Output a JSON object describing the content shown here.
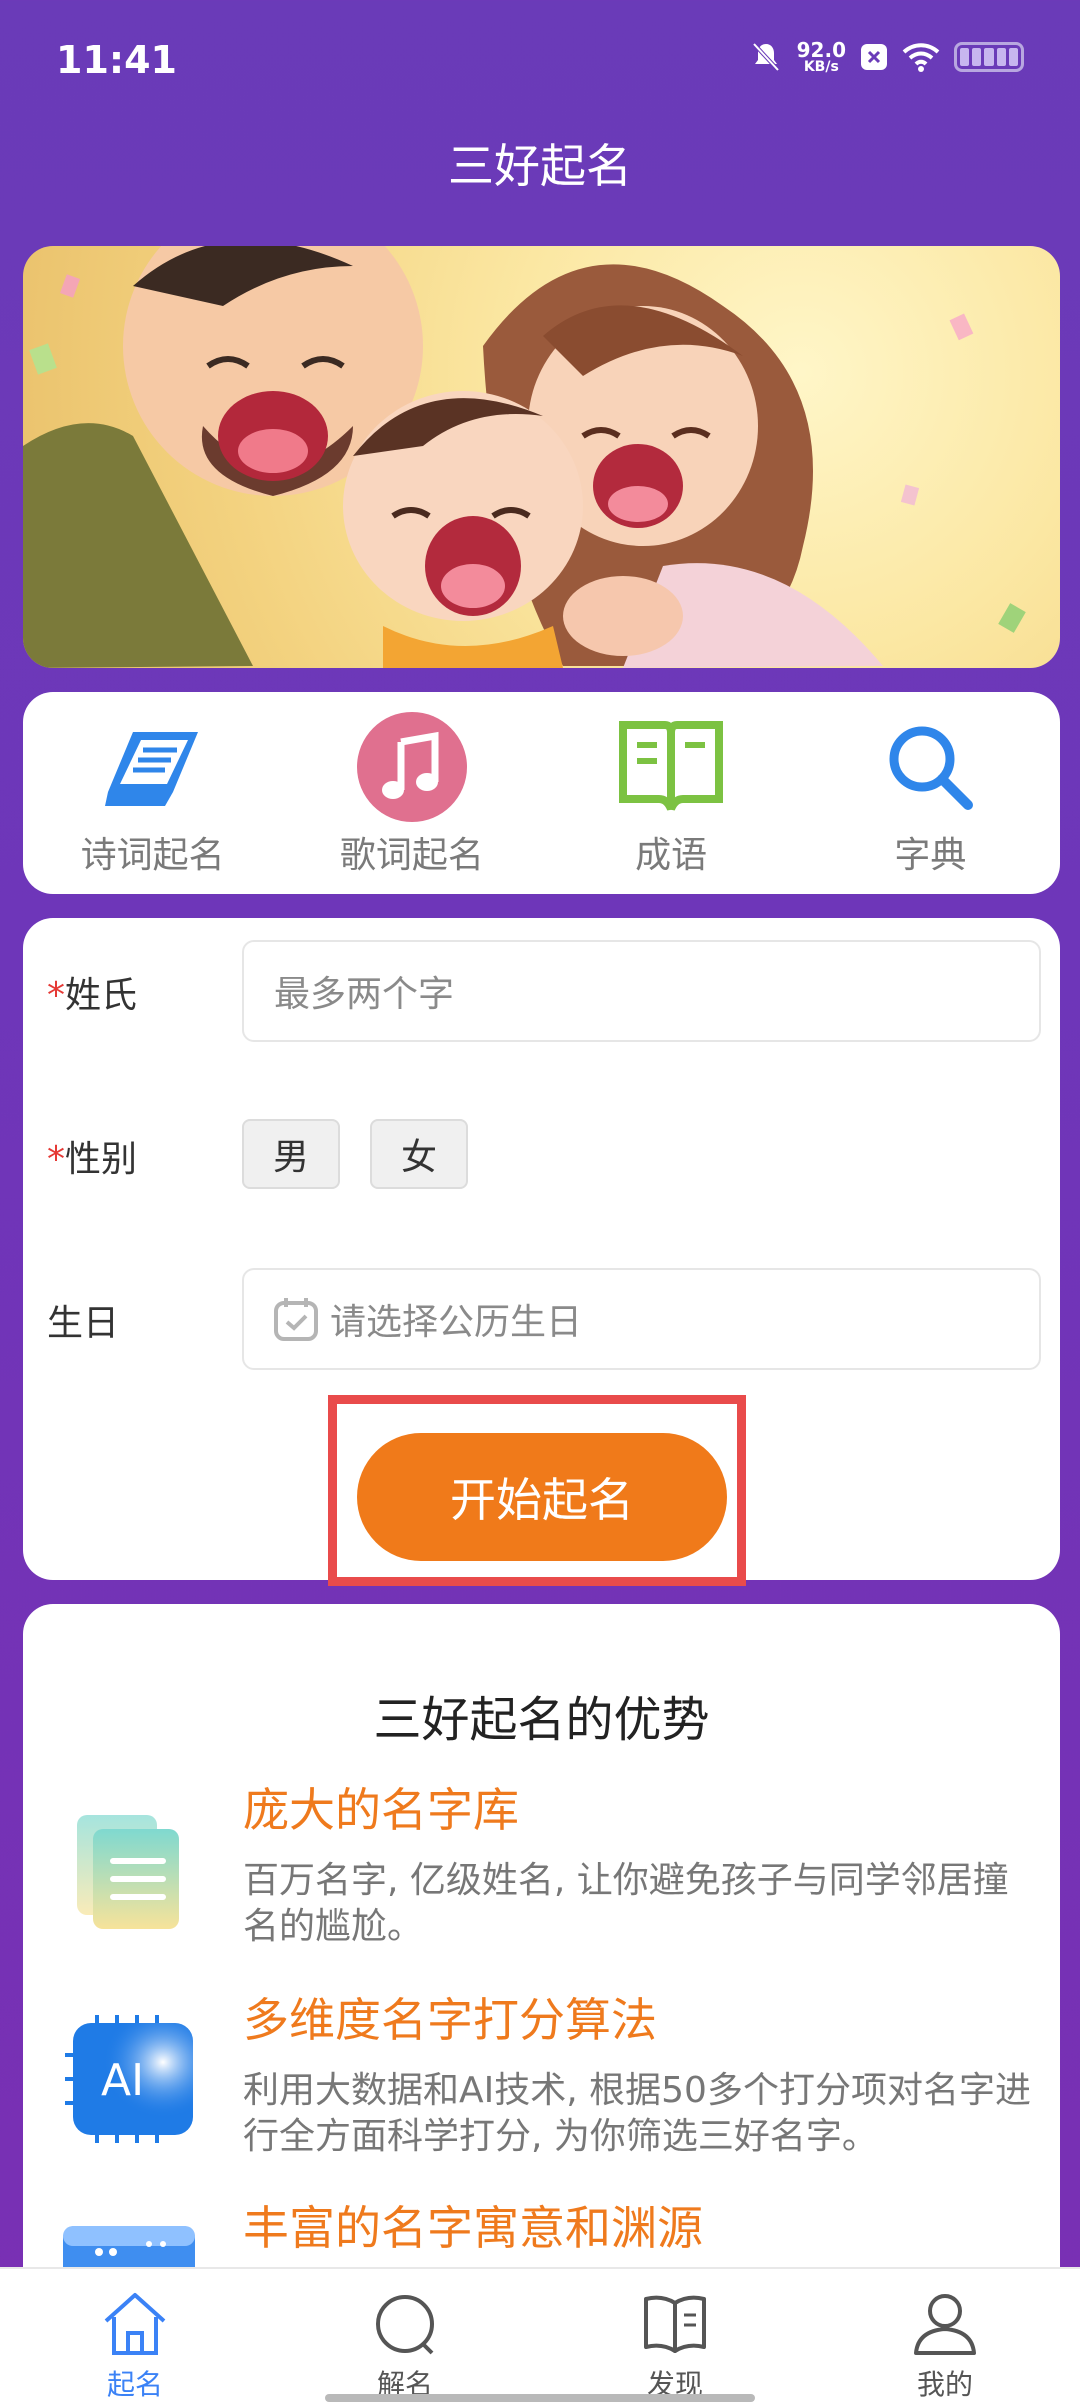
{
  "status": {
    "time": "11:41",
    "net_speed": "92.0",
    "net_unit": "KB/s"
  },
  "app_title": "三好起名",
  "quick_links": [
    {
      "label": "诗词起名",
      "icon": "book-icon",
      "color": "#2f86ea"
    },
    {
      "label": "歌词起名",
      "icon": "music-note-icon",
      "color": "#e0708f"
    },
    {
      "label": "成语",
      "icon": "open-book-icon",
      "color": "#7cc242"
    },
    {
      "label": "字典",
      "icon": "search-icon",
      "color": "#2f86ea"
    }
  ],
  "form": {
    "surname_label": "姓氏",
    "surname_placeholder": "最多两个字",
    "gender_label": "性别",
    "gender_options": [
      "男",
      "女"
    ],
    "birthday_label": "生日",
    "birthday_placeholder": "请选择公历生日",
    "required_mark": "*",
    "start_button": "开始起名"
  },
  "advantages": {
    "title": "三好起名的优势",
    "items": [
      {
        "title": "庞大的名字库",
        "desc": "百万名字, 亿级姓名, 让你避免孩子与同学邻居撞名的尴尬。"
      },
      {
        "title": "多维度名字打分算法",
        "desc": "利用大数据和AI技术, 根据50多个打分项对名字进行全方面科学打分, 为你筛选三好名字。"
      },
      {
        "title": "丰富的名字寓意和渊源",
        "desc": ""
      }
    ],
    "ai_icon_text": "AI"
  },
  "nav": {
    "items": [
      {
        "label": "起名",
        "icon": "home-icon",
        "active": true
      },
      {
        "label": "解名",
        "icon": "search-icon",
        "active": false
      },
      {
        "label": "发现",
        "icon": "book-icon",
        "active": false
      },
      {
        "label": "我的",
        "icon": "user-icon",
        "active": false
      }
    ]
  },
  "colors": {
    "accent_orange": "#f07a1a",
    "brand_purple": "#6a3bb8",
    "active_blue": "#3b82f6"
  }
}
